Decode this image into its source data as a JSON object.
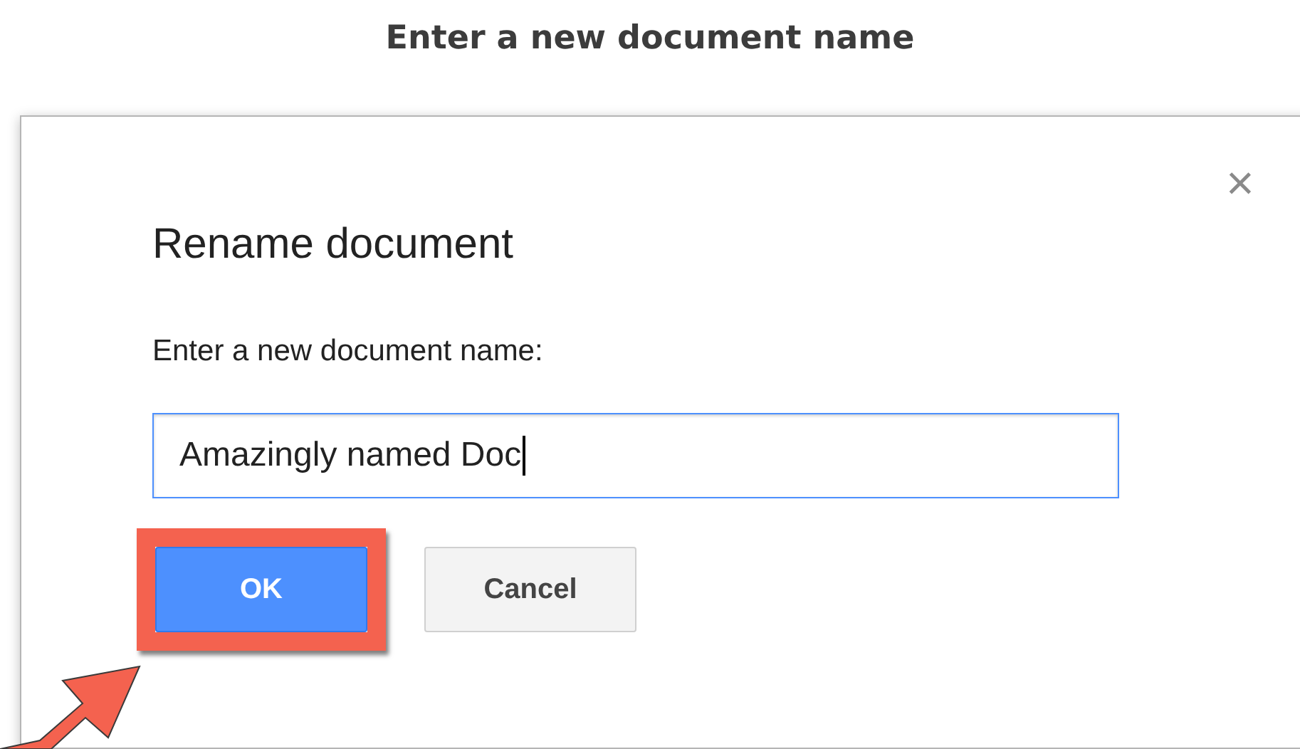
{
  "heading": "Enter a new document name",
  "dialog": {
    "close": "×",
    "title": "Rename document",
    "prompt": "Enter a new document name:",
    "field": {
      "value": "Amazingly named Doc",
      "focused": true
    },
    "buttons": [
      {
        "label": "OK",
        "kind": "primary",
        "highlighted": true
      },
      {
        "label": "Cancel",
        "kind": "secondary",
        "highlighted": false
      }
    ]
  }
}
